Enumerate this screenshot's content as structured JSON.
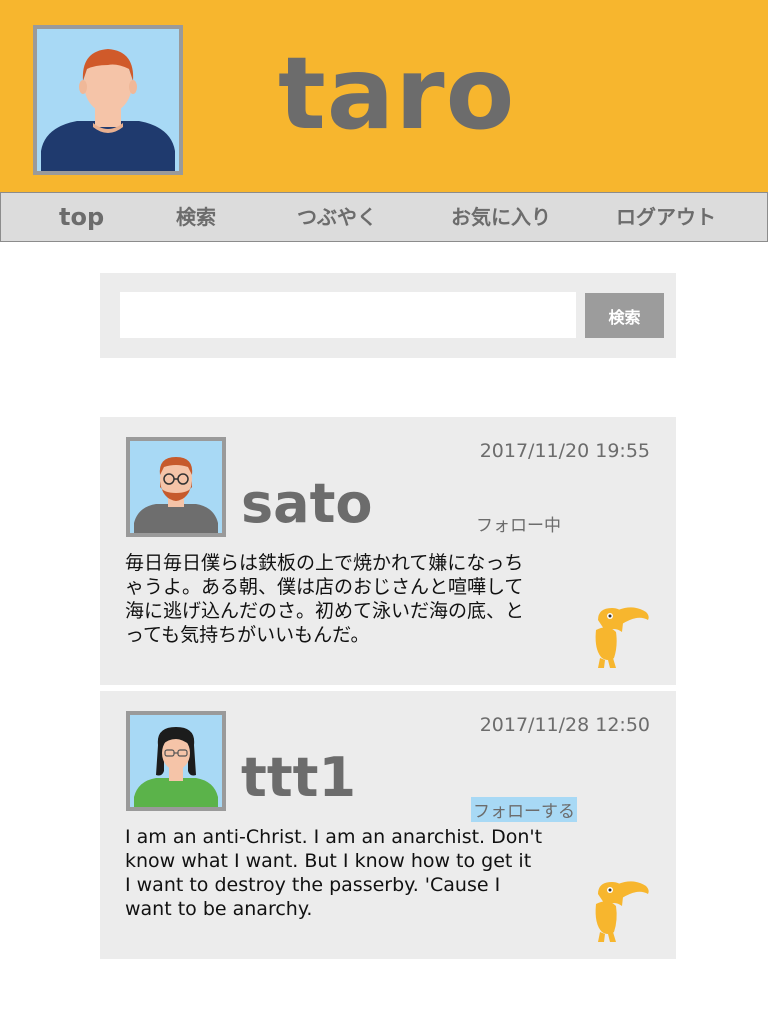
{
  "header": {
    "username": "taro"
  },
  "nav": {
    "items": [
      {
        "label": "top"
      },
      {
        "label": "検索"
      },
      {
        "label": "つぶやく"
      },
      {
        "label": "お気に入り"
      },
      {
        "label": "ログアウト"
      }
    ]
  },
  "search": {
    "value": "",
    "placeholder": "",
    "button_label": "検索"
  },
  "posts": [
    {
      "name": "sato",
      "timestamp": "2017/11/20 19:55",
      "follow_label": "フォロー中",
      "lines": [
        "毎日毎日僕らは鉄板の上で焼かれて嫌になっち",
        "ゃうよ。ある朝、僕は店のおじさんと喧嘩して",
        "海に逃げ込んだのさ。初めて泳いだ海の底、と",
        "っても気持ちがいいもんだ。"
      ]
    },
    {
      "name": "ttt1",
      "timestamp": "2017/11/28 12:50",
      "follow_label": "フォローする",
      "lines": [
        "I am an anti-Christ. I am an anarchist. Don't",
        "know what I want. But I know how to get it",
        "I want to destroy the passerby. 'Cause I",
        "want to be anarchy."
      ]
    }
  ],
  "colors": {
    "header_bg": "#f7b62e",
    "nav_bg": "#dcdcdc",
    "text_gray": "#6c6c6c",
    "panel_bg": "#ececec",
    "avatar_bg": "#a8d9f5",
    "toucan": "#f7b62e",
    "follow_highlight": "#a8d9f5"
  },
  "icons": {
    "favorite": "toucan-icon"
  }
}
